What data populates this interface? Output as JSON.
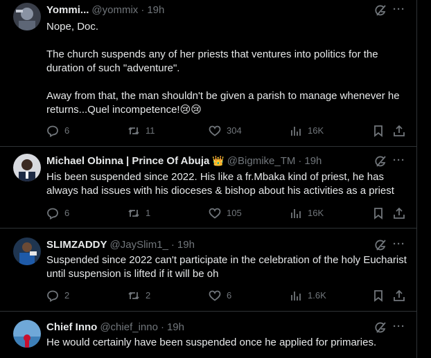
{
  "tweets": [
    {
      "name": "Yommi...",
      "handle": "@yommix",
      "sep": "·",
      "time": "19h",
      "lines": [
        "Nope, Doc.",
        "The church suspends any of her priests that ventures into politics for the duration of such \"adventure\".",
        "Away from that, the man shouldn't be given a parish to manage whenever he returns...Quel incompetence!😢😢"
      ],
      "replies": "6",
      "reposts": "11",
      "likes": "304",
      "views": "16K"
    },
    {
      "name": "Michael Obinna | Prince Of Abuja",
      "badge": "👑",
      "handle": "@Bigmike_TM",
      "sep": "·",
      "time": "19h",
      "lines": [
        "His been suspended since 2022. His like a fr.Mbaka kind of priest, he has always had issues with his dioceses & bishop about his activities as a priest"
      ],
      "replies": "6",
      "reposts": "1",
      "likes": "105",
      "views": "16K"
    },
    {
      "name": "SLIMZADDY",
      "handle": "@JaySlim1_",
      "sep": "·",
      "time": "19h",
      "lines": [
        "Suspended since 2022 can't participate in the celebration of the holy Eucharist until suspension is lifted if it will be oh"
      ],
      "replies": "2",
      "reposts": "2",
      "likes": "6",
      "views": "1.6K"
    },
    {
      "name": "Chief Inno",
      "handle": "@chief_inno",
      "sep": "·",
      "time": "19h",
      "lines": [
        "He would certainly have been suspended once he applied for primaries."
      ]
    }
  ],
  "icons": {
    "grok": "grok-icon",
    "more": "more-icon",
    "more_glyph": "···",
    "reply": "reply-icon",
    "repost": "repost-icon",
    "like": "like-icon",
    "views": "views-icon",
    "bookmark": "bookmark-icon",
    "share": "share-icon"
  },
  "colors": {
    "background": "#000000",
    "text": "#e7e9ea",
    "muted": "#71767b",
    "border": "#2f3336"
  }
}
